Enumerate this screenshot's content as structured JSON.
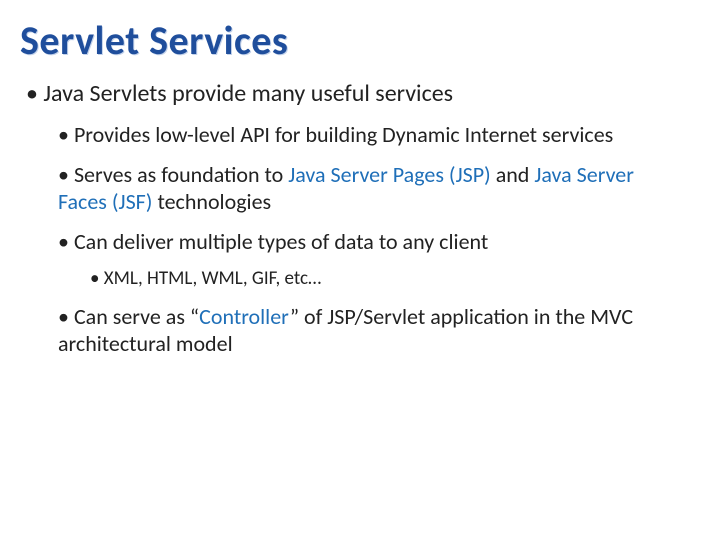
{
  "title": "Servlet Services",
  "b1": "Java Servlets provide many useful services",
  "b2a": "Provides low-level API for building Dynamic Internet services",
  "b2b_pre": "Serves as foundation to ",
  "b2b_h1": "Java Server Pages (JSP)",
  "b2b_mid": " and ",
  "b2b_h2": "Java Server Faces (JSF)",
  "b2b_post": " technologies",
  "b2c": "Can deliver multiple types of data to any client",
  "b3a": "XML, HTML, WML, GIF, etc…",
  "b2d_pre": "Can serve as “",
  "b2d_h1": "Controller",
  "b2d_post": "” of JSP/Servlet application in the MVC architectural model"
}
